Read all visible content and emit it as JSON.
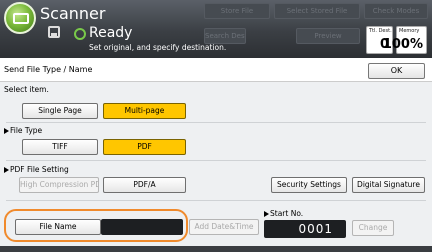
{
  "header": {
    "app_title": "Scanner",
    "top_buttons": [
      "Store File",
      "Select Stored File",
      "Check Modes"
    ],
    "search_dest": "Search Dest.",
    "preview": "Preview",
    "status": "Ready",
    "status_sub": "Set original, and specify destination.",
    "counter_dest_label": "Ttl. Dest.",
    "counter_dest_value": "0",
    "counter_memory_label": "Memory",
    "counter_memory_value": "100%"
  },
  "titlebar": {
    "title": "Send File Type / Name",
    "ok_label": "OK"
  },
  "select_item": {
    "label": "Select item.",
    "options": [
      "Single Page",
      "Multi-page"
    ],
    "selected": "Multi-page"
  },
  "file_type": {
    "label": "File Type",
    "options": [
      "TIFF",
      "PDF"
    ],
    "selected": "PDF"
  },
  "pdf_setting": {
    "label": "PDF File Setting",
    "high_compression": "High Compression PDF",
    "pdfa": "PDF/A",
    "security": "Security Settings",
    "signature": "Digital Signature"
  },
  "name_row": {
    "file_name_label": "File Name",
    "file_name_value": "",
    "add_date": "Add Date&Time",
    "start_no_label": "Start No.",
    "start_no_value": "0001",
    "change": "Change"
  },
  "colors": {
    "selected": "#ffc600",
    "highlight": "#f08a2c",
    "logo": "#7dbb3c"
  }
}
